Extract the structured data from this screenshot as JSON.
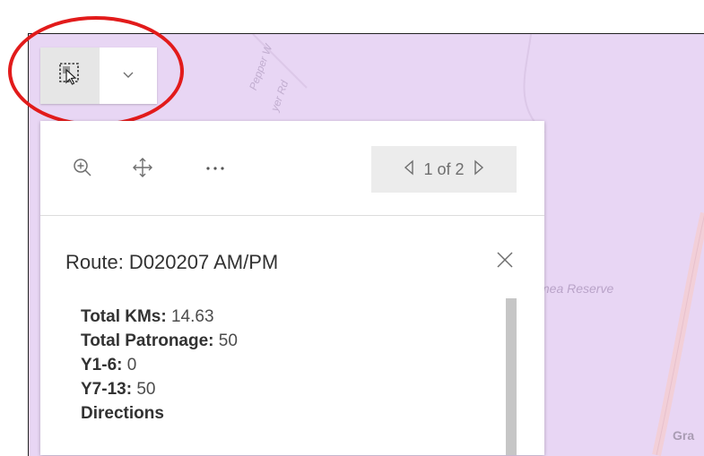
{
  "map": {
    "labels": {
      "road_top": "Pepper W",
      "road_side": "yer Rd",
      "reserve": "mea Reserve",
      "corner": "Gra"
    }
  },
  "tool_widget": {
    "select_icon": "select-by-rectangle-icon",
    "dropdown_icon": "chevron-down-icon",
    "highlight_color": "#e21b1b"
  },
  "popup": {
    "toolbar": {
      "zoom_icon": "zoom-in-icon",
      "pan_icon": "pan-move-icon",
      "more_icon": "more-horizontal-icon",
      "pager_text": "1 of 2"
    },
    "title": "Route: D020207 AM/PM",
    "fields": [
      {
        "label": "Total KMs:",
        "value": "14.63"
      },
      {
        "label": "Total Patronage:",
        "value": "50"
      },
      {
        "label": "Y1-6:",
        "value": "0"
      },
      {
        "label": "Y7-13:",
        "value": "50"
      },
      {
        "label": "Directions",
        "value": ""
      }
    ]
  },
  "colors": {
    "map_bg": "#e8d6f4",
    "road": "#f2cfd8",
    "panel_bg": "#ffffff"
  }
}
